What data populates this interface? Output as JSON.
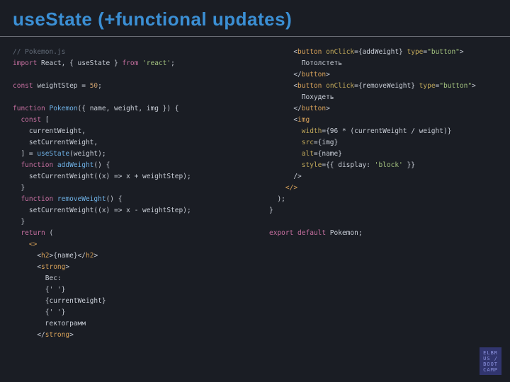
{
  "title": "useState (+functional updates)",
  "code_left": {
    "l01": "// Pokemon.js",
    "l02a": "import",
    "l02b": " React, { useState } ",
    "l02c": "from",
    "l02d": " 'react'",
    "l02e": ";",
    "l03a": "const",
    "l03b": " weightStep = ",
    "l03c": "50",
    "l03d": ";",
    "l04a": "function",
    "l04b": " Pokemon",
    "l04c": "({ name, weight, img }) {",
    "l05a": "  const",
    "l05b": " [",
    "l06": "    currentWeight,",
    "l07": "    setCurrentWeight,",
    "l08a": "  ] = ",
    "l08b": "useState",
    "l08c": "(weight);",
    "l09a": "  function",
    "l09b": " addWeight",
    "l09c": "() {",
    "l10": "    setCurrentWeight((x) => x + weightStep);",
    "l11": "  }",
    "l12a": "  function",
    "l12b": " removeWeight",
    "l12c": "() {",
    "l13": "    setCurrentWeight((x) => x - weightStep);",
    "l14": "  }",
    "l15a": "  return",
    "l15b": " (",
    "l16": "    <>",
    "l17a": "      <",
    "l17b": "h2",
    "l17c": ">{name}</",
    "l17d": "h2",
    "l17e": ">",
    "l18a": "      <",
    "l18b": "strong",
    "l18c": ">",
    "l19": "        Вес:",
    "l20": "        {' '}",
    "l21": "        {currentWeight}",
    "l22": "        {' '}",
    "l23": "        гектограмм",
    "l24a": "      </",
    "l24b": "strong",
    "l24c": ">"
  },
  "code_right": {
    "r01a": "      <",
    "r01b": "button",
    "r01c": " onClick",
    "r01d": "={addWeight} ",
    "r01e": "type",
    "r01f": "=",
    "r01g": "\"button\"",
    "r01h": ">",
    "r02": "        Потолстеть",
    "r03a": "      </",
    "r03b": "button",
    "r03c": ">",
    "r04a": "      <",
    "r04b": "button",
    "r04c": " onClick",
    "r04d": "={removeWeight} ",
    "r04e": "type",
    "r04f": "=",
    "r04g": "\"button\"",
    "r04h": ">",
    "r05": "        Похудеть",
    "r06a": "      </",
    "r06b": "button",
    "r06c": ">",
    "r07a": "      <",
    "r07b": "img",
    "r08a": "        width",
    "r08b": "={96 * (currentWeight / weight)}",
    "r09a": "        src",
    "r09b": "={img}",
    "r10a": "        alt",
    "r10b": "={name}",
    "r11a": "        style",
    "r11b": "={{ display: ",
    "r11c": "'block'",
    "r11d": " }}",
    "r12": "      />",
    "r13": "    </>",
    "r14": "  );",
    "r15": "}",
    "r16a": "export default",
    "r16b": " Pokemon;"
  },
  "logo": "ELBR\nUS /\nBOOT\nCAMP"
}
